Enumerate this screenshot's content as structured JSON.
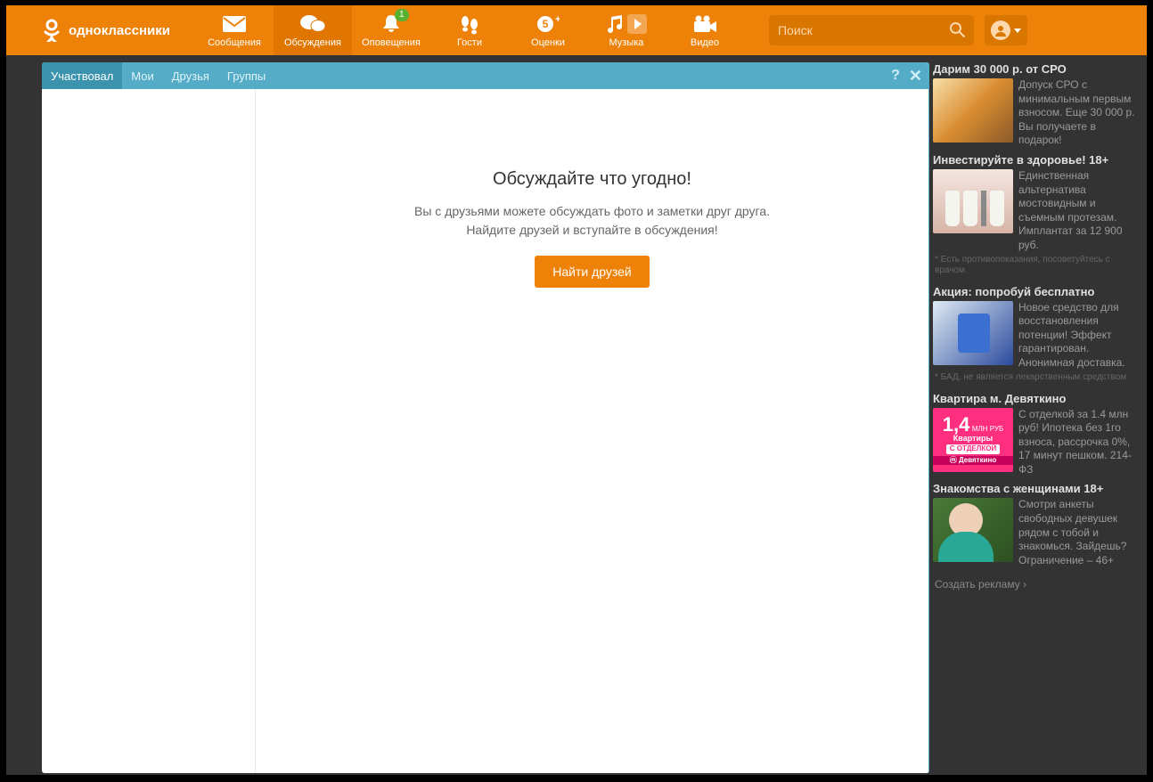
{
  "brand": {
    "name": "одноклассники"
  },
  "nav": {
    "items": [
      {
        "key": "messages",
        "label": "Сообщения"
      },
      {
        "key": "discussions",
        "label": "Обсуждения",
        "active": true
      },
      {
        "key": "notifications",
        "label": "Оповещения",
        "badge": "1"
      },
      {
        "key": "guests",
        "label": "Гости"
      },
      {
        "key": "marks",
        "label": "Оценки"
      },
      {
        "key": "music",
        "label": "Музыка"
      },
      {
        "key": "video",
        "label": "Видео"
      }
    ]
  },
  "search": {
    "placeholder": "Поиск"
  },
  "panel": {
    "tabs": [
      {
        "key": "participated",
        "label": "Участвовал",
        "active": true
      },
      {
        "key": "my",
        "label": "Мои"
      },
      {
        "key": "friends",
        "label": "Друзья"
      },
      {
        "key": "groups",
        "label": "Группы"
      }
    ]
  },
  "empty": {
    "title": "Обсуждайте что угодно!",
    "line1": "Вы с друзьями можете обсуждать фото и заметки друг друга.",
    "line2": "Найдите друзей и вступайте в обсуждения!",
    "cta": "Найти друзей"
  },
  "ads": [
    {
      "title": "Дарим 30 000 р. от СРО",
      "text": "Допуск СРО с минимальным первым взносом. Еще 30 000 р. Вы получаете в подарок!",
      "img": "img1"
    },
    {
      "title": "Инвестируйте в здоровье! 18+",
      "text": "Единственная альтернатива мостовидным и съемным протезам. Имплантат за 12 900 руб.",
      "img": "img2",
      "disclaimer": "* Есть противопоказания, посоветуйтесь с врачом."
    },
    {
      "title": "Акция: попробуй бесплатно",
      "text": "Новое средство для восстановления потенции! Эффект гарантирован. Анонимная доставка.",
      "img": "img3",
      "disclaimer": "* БАД, не является лекарственным средством"
    },
    {
      "title": "Квартира м. Девяткино",
      "text": "С отделкой за 1.4 млн руб! Ипотека без 1го взноса, рассрочка 0%, 17 минут пешком. 214-ФЗ",
      "img": "img4"
    },
    {
      "title": "Знакомства с женщинами 18+",
      "text": "Смотри анкеты свободных девушек рядом с тобой и знакомься. Зайдешь? Ограничение – 46+",
      "img": "img5"
    }
  ],
  "ad4_overlay": {
    "big": "1,4",
    "unit": "МЛН РУБ",
    "line": "Квартиры",
    "bar": "С ОТДЕЛКОЙ",
    "bar2": "ⓜ Девяткино"
  },
  "create_ad": "Создать рекламу ›"
}
